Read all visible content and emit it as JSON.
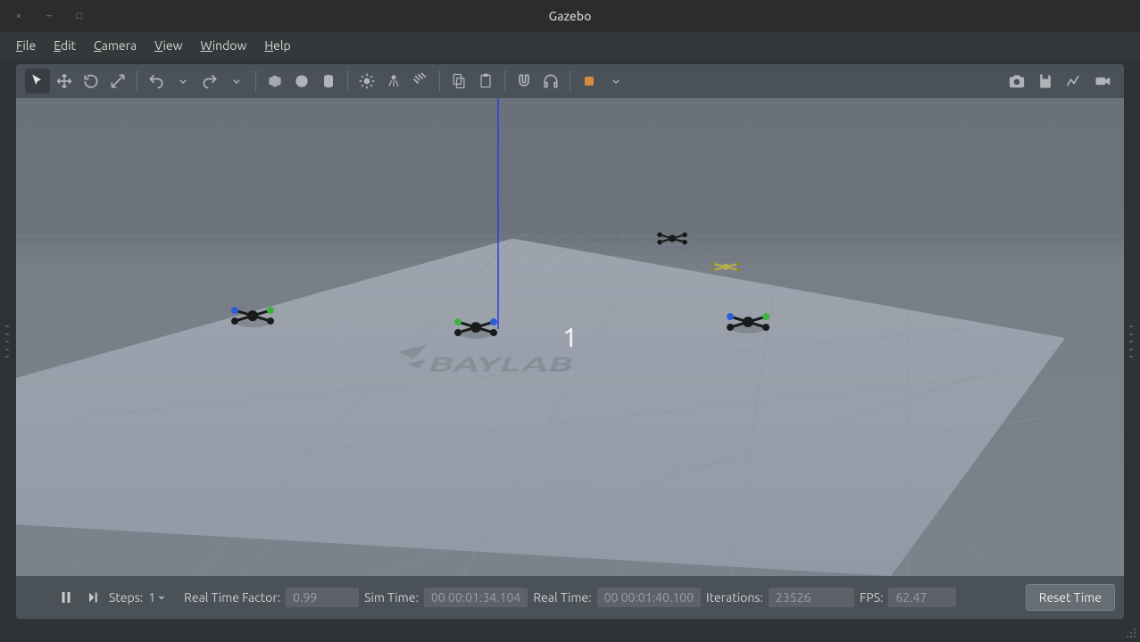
{
  "window": {
    "title": "Gazebo",
    "controls": {
      "close": "×",
      "minimize": "–",
      "maximize": "□"
    }
  },
  "menubar": {
    "file": "File",
    "edit": "Edit",
    "camera": "Camera",
    "view": "View",
    "window": "Window",
    "help": "Help"
  },
  "toolbar": {
    "select": "select-tool",
    "translate": "translate-tool",
    "rotate": "rotate-tool",
    "scale": "scale-tool",
    "undo": "undo",
    "redo": "redo",
    "box": "box-shape",
    "sphere": "sphere-shape",
    "cylinder": "cylinder-shape",
    "point_light": "point-light",
    "spot_light": "spot-light",
    "directional_light": "directional-light",
    "copy": "copy",
    "paste": "paste",
    "snap": "snap-align",
    "joints": "joints",
    "gz_logo": "gazebo-logo",
    "screenshot": "screenshot",
    "log": "log-data",
    "plot": "plot",
    "record": "record-video"
  },
  "viewport": {
    "overlay_number": "1",
    "ground_logo_text": "BAYLAB"
  },
  "statusbar": {
    "pause": "pause",
    "step": "step",
    "steps_label": "Steps:",
    "steps_value": "1",
    "rtf_label": "Real Time Factor:",
    "rtf_value": "0.99",
    "sim_time_label": "Sim Time:",
    "sim_time_value": "00 00:01:34.104",
    "real_time_label": "Real Time:",
    "real_time_value": "00 00:01:40.100",
    "iterations_label": "Iterations:",
    "iterations_value": "23526",
    "fps_label": "FPS:",
    "fps_value": "62.47",
    "reset_label": "Reset Time"
  },
  "colors": {
    "bg": "#2e3436",
    "panel": "#4a5258",
    "viewport": "#6d737d",
    "text": "#d3d7cf",
    "muted": "#9aa0a5"
  }
}
